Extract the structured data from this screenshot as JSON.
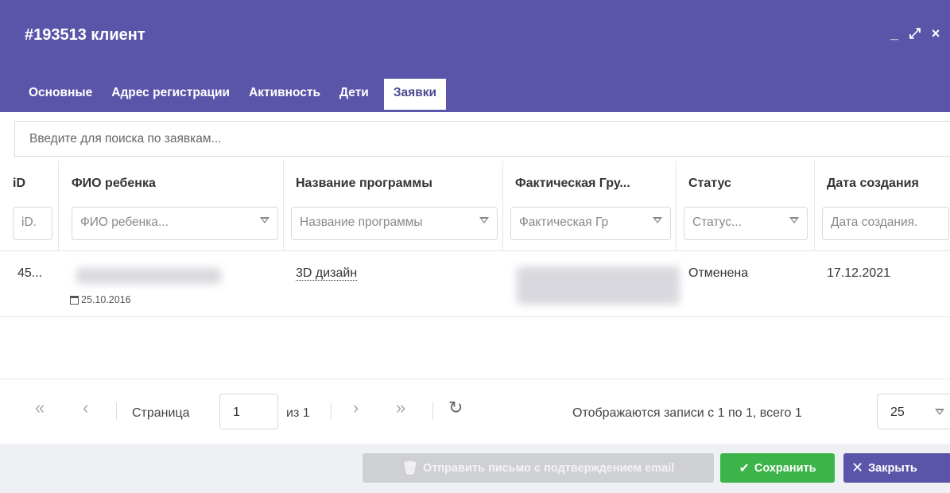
{
  "window": {
    "title": "#193513 клиент",
    "controls": [
      "_",
      "⤢",
      "×"
    ]
  },
  "tabs": [
    {
      "label": "Основные",
      "active": false
    },
    {
      "label": "Адрес регистрации",
      "active": false
    },
    {
      "label": "Активность",
      "active": false
    },
    {
      "label": "Дети",
      "active": false
    },
    {
      "label": "Заявки",
      "active": true
    }
  ],
  "search": {
    "placeholder": "Введите для поиска по заявкам..."
  },
  "table": {
    "columns": [
      {
        "header": "iD",
        "filter": "iD."
      },
      {
        "header": "ФИО ребенка",
        "filter": "ФИО ребенка..."
      },
      {
        "header": "Название программы",
        "filter": "Название программы"
      },
      {
        "header": "Фактическая Гру...",
        "filter": "Фактическая Гр"
      },
      {
        "header": "Статус",
        "filter": "Статус..."
      },
      {
        "header": "Дата создания",
        "filter": "Дата создания."
      }
    ],
    "rows": [
      {
        "id": "45...",
        "child_dob": "25.10.2016",
        "program": "3D дизайн",
        "status": "Отменена",
        "created": "17.12.2021"
      }
    ]
  },
  "pager": {
    "page_label": "Страница",
    "page": "1",
    "of_label": "из 1",
    "summary": "Отображаются записи с 1 по 1, всего 1",
    "page_size": "25"
  },
  "footer": {
    "email_button": "Отправить письмо с подтверждением email",
    "save_button": "Сохранить",
    "close_button": "Закрыть"
  },
  "colors": {
    "header": "#5b55a9",
    "save": "#3db44a",
    "disabled": "#cfd0d4"
  }
}
